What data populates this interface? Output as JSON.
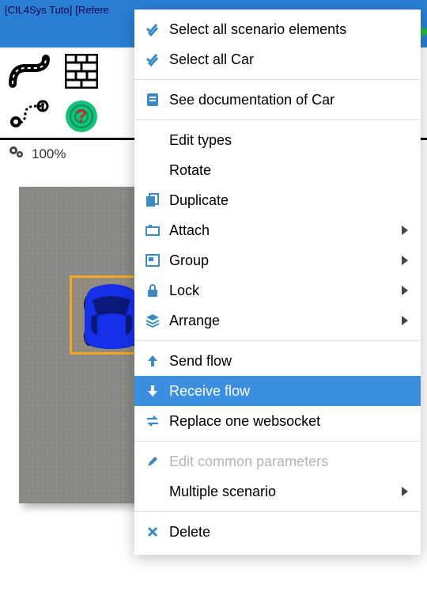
{
  "title": {
    "part1": "[CIL4Sys Tuto]",
    "part2": "[Refere"
  },
  "status": {
    "zoom": "100%"
  },
  "canvas": {
    "selected_object": "car"
  },
  "menu": {
    "items": [
      {
        "label": "Select all scenario elements",
        "icon": "check-all",
        "submenu": false,
        "disabled": false
      },
      {
        "label": "Select all Car",
        "icon": "check-all",
        "submenu": false,
        "disabled": false
      },
      {
        "sep": true
      },
      {
        "label": "See documentation of Car",
        "icon": "doc",
        "submenu": false,
        "disabled": false
      },
      {
        "sep": true
      },
      {
        "label": "Edit types",
        "icon": "",
        "submenu": false,
        "disabled": false
      },
      {
        "label": "Rotate",
        "icon": "",
        "submenu": false,
        "disabled": false
      },
      {
        "label": "Duplicate",
        "icon": "copy",
        "submenu": false,
        "disabled": false
      },
      {
        "label": "Attach",
        "icon": "attach",
        "submenu": true,
        "disabled": false
      },
      {
        "label": "Group",
        "icon": "group",
        "submenu": true,
        "disabled": false
      },
      {
        "label": "Lock",
        "icon": "lock",
        "submenu": true,
        "disabled": false
      },
      {
        "label": "Arrange",
        "icon": "layers",
        "submenu": true,
        "disabled": false
      },
      {
        "sep": true
      },
      {
        "label": "Send flow",
        "icon": "arrow-up",
        "submenu": false,
        "disabled": false
      },
      {
        "label": "Receive flow",
        "icon": "arrow-down",
        "submenu": false,
        "disabled": false,
        "highlight": true
      },
      {
        "label": "Replace one websocket",
        "icon": "swap",
        "submenu": false,
        "disabled": false
      },
      {
        "sep": true
      },
      {
        "label": "Edit common parameters",
        "icon": "pencil",
        "submenu": false,
        "disabled": true
      },
      {
        "label": "Multiple scenario",
        "icon": "",
        "submenu": true,
        "disabled": false
      },
      {
        "sep": true
      },
      {
        "label": "Delete",
        "icon": "delete",
        "submenu": false,
        "disabled": false
      }
    ]
  }
}
